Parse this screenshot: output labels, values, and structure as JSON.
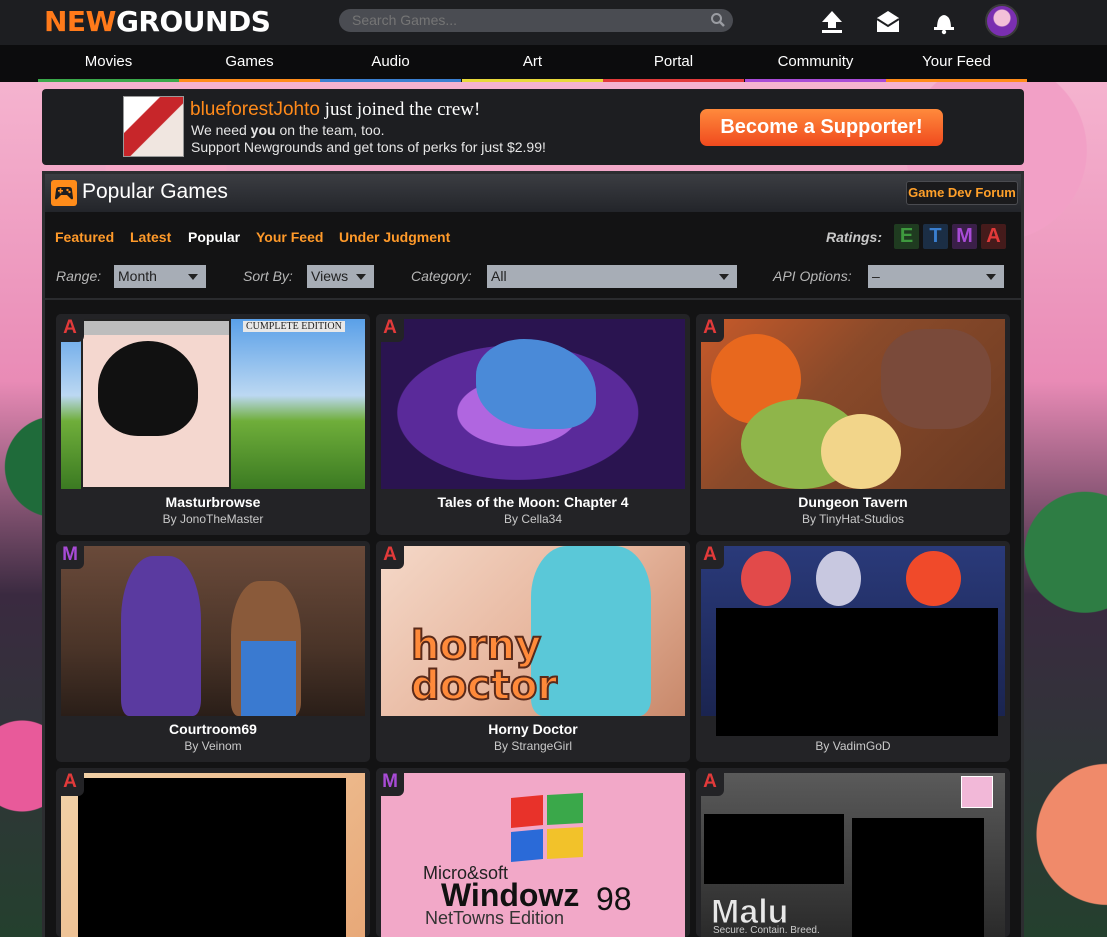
{
  "colors": {
    "brand_orange": "#ff7a1a",
    "link_orange": "#ff9a2a",
    "rating_e": "#3e9a3e",
    "rating_t": "#3a7fd0",
    "rating_m": "#a84bd6",
    "rating_a": "#e23a3a"
  },
  "header": {
    "logo_new": "NEW",
    "logo_grounds": "GROUNDS",
    "search_placeholder": "Search Games...",
    "icons": [
      "upload-icon",
      "mail-icon",
      "notification-bell-icon",
      "user-avatar"
    ]
  },
  "nav": {
    "items": [
      {
        "label": "Movies",
        "color": "#3aa84a"
      },
      {
        "label": "Games",
        "color": "#ff8c1a"
      },
      {
        "label": "Audio",
        "color": "#3a7fd0"
      },
      {
        "label": "Art",
        "color": "#e8d93a"
      },
      {
        "label": "Portal",
        "color": "#e23a3a"
      },
      {
        "label": "Community",
        "color": "#a84bd6"
      },
      {
        "label": "Your Feed",
        "color": "#ff8c1a"
      }
    ]
  },
  "promo": {
    "username": "blueforestJohto",
    "joined_text": " just joined the crew!",
    "line2_pre": "We need ",
    "line2_bold": "you",
    "line2_post": " on the team, too.",
    "line3": "Support Newgrounds and get tons of perks for just $2.99!",
    "button": "Become a Supporter!"
  },
  "panel": {
    "title": "Popular Games",
    "forum_button": "Game Dev Forum",
    "tabs": [
      {
        "label": "Featured",
        "active": false
      },
      {
        "label": "Latest",
        "active": false
      },
      {
        "label": "Popular",
        "active": true
      },
      {
        "label": "Your Feed",
        "active": false
      },
      {
        "label": "Under Judgment",
        "active": false
      }
    ],
    "ratings_label": "Ratings:",
    "ratings": [
      "E",
      "T",
      "M",
      "A"
    ],
    "filters": {
      "range_label": "Range:",
      "range_value": "Month",
      "sort_label": "Sort By:",
      "sort_value": "Views",
      "category_label": "Category:",
      "category_value": "All",
      "api_label": "API Options:",
      "api_value": "–"
    }
  },
  "games": [
    {
      "title": "Masturbrowse",
      "author": "By JonoTheMaster",
      "rating": "A",
      "thumb_caption": "CUMPLETE EDITION"
    },
    {
      "title": "Tales of the Moon: Chapter 4",
      "author": "By Cella34",
      "rating": "A"
    },
    {
      "title": "Dungeon Tavern",
      "author": "By TinyHat-Studios",
      "rating": "A"
    },
    {
      "title": "Courtroom69",
      "author": "By Veinom",
      "rating": "M"
    },
    {
      "title": "Horny Doctor",
      "author": "By StrangeGirl",
      "rating": "A",
      "thumb_text": "horny doctor"
    },
    {
      "title": "",
      "author": "By VadimGoD",
      "rating": "A"
    },
    {
      "title": "",
      "author": "",
      "rating": "A"
    },
    {
      "title": "",
      "author": "",
      "rating": "M",
      "thumb_text_1": "Micro&soft",
      "thumb_text_2": "Windowz",
      "thumb_text_3": "98",
      "thumb_text_4": "NetTowns Edition"
    },
    {
      "title": "",
      "author": "",
      "rating": "A",
      "thumb_text": "Malu",
      "thumb_subtext": "Secure. Contain. Breed."
    }
  ]
}
